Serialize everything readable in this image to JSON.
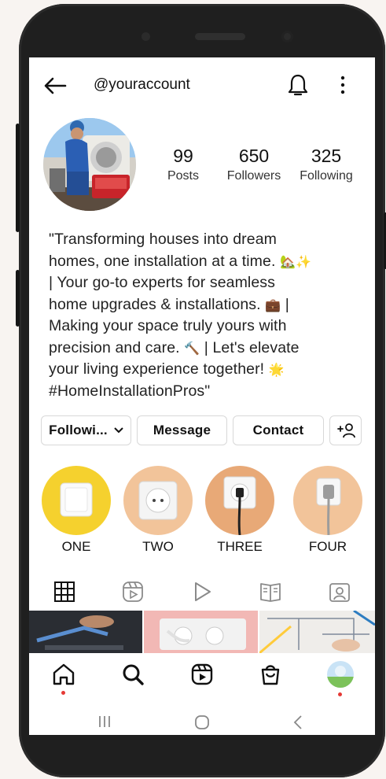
{
  "header": {
    "username": "@youraccount",
    "icons": [
      "back-arrow-icon",
      "bell-icon",
      "more-vertical-icon"
    ]
  },
  "profile": {
    "stats": [
      {
        "value": "99",
        "label": "Posts"
      },
      {
        "value": "650",
        "label": "Followers"
      },
      {
        "value": "325",
        "label": "Following"
      }
    ],
    "bio": {
      "line1": "\"Transforming houses into dream",
      "line2": "homes, one installation at a time.",
      "line3": "| Your go-to experts for seamless",
      "line4": "home upgrades & installations.",
      "line5": "Making your space truly yours with",
      "line6": "precision and care.",
      "line6b": "| Let's elevate",
      "line7": "your living experience together!",
      "line8": "#HomeInstallationPros\"",
      "emoji_house": "🏡",
      "emoji_sparkle": "✨",
      "emoji_briefcase": "💼",
      "emoji_hammer": "🔨",
      "emoji_sun": "🌟"
    }
  },
  "actions": {
    "following_label": "Followi...",
    "message_label": "Message",
    "contact_label": "Contact"
  },
  "highlights": [
    {
      "label": "ONE",
      "bg": "#f5d12e"
    },
    {
      "label": "TWO",
      "bg": "#f2c49a"
    },
    {
      "label": "THREE",
      "bg": "#e8a977"
    },
    {
      "label": "FOUR",
      "bg": "#f2c49a"
    }
  ],
  "tabs": [
    "grid-icon",
    "reels-icon",
    "play-icon",
    "guides-icon",
    "tagged-icon"
  ],
  "nav": [
    "home-icon",
    "search-icon",
    "reels-icon",
    "shop-icon",
    "profile-avatar"
  ],
  "system_nav": [
    "recents-icon",
    "home-circle-icon",
    "back-chevron-icon"
  ],
  "colors": {
    "accent_red": "#e53935",
    "text": "#111111",
    "border": "#d8d8d8"
  }
}
